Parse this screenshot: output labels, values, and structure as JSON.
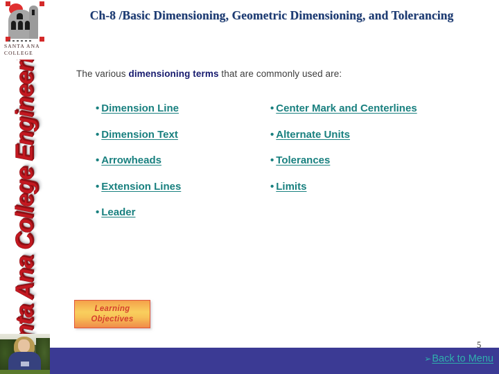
{
  "slide": {
    "title": "Ch-8 /Basic Dimensioning, Geometric Dimensioning, and Tolerancing",
    "subtitle": {
      "before": "The various ",
      "emphasis": "dimensioning terms",
      "after": " that are commonly used are:"
    },
    "page_number": "5"
  },
  "sidebar": {
    "logo": {
      "line1": "SANTA ANA",
      "line2": "COLLEGE",
      "icon": "mission-building-icon"
    },
    "banner_text": "Santa Ana College Engineering",
    "photo_alt": "instructor-photo"
  },
  "bullets": {
    "left_column": [
      {
        "dot": "•",
        "label": "Dimension Line"
      },
      {
        "dot": "•",
        "label": "Dimension Text"
      },
      {
        "dot": "•",
        "label": "Arrowheads"
      },
      {
        "dot": "•",
        "label": "Extension Lines"
      },
      {
        "dot": "•",
        "label": "Leader"
      }
    ],
    "right_column": [
      {
        "dot": "•",
        "label": "Center Mark and Centerlines"
      },
      {
        "dot": "•",
        "label": "Alternate Units"
      },
      {
        "dot": "•",
        "label": "Tolerances"
      },
      {
        "dot": "•",
        "label": "Limits"
      }
    ]
  },
  "learning_objectives": {
    "line1": "Learning",
    "line2": "Objectives"
  },
  "footer": {
    "arrow_glyph": "➢",
    "back_label": "Back to Menu"
  },
  "colors": {
    "title_navy": "#1b3a72",
    "link_teal": "#19807f",
    "footer_bar": "#3b3a94",
    "banner_red": "#c31820",
    "objectives_border": "#e0553b",
    "objectives_text": "#d6402c",
    "footer_link": "#2fb0ad"
  }
}
